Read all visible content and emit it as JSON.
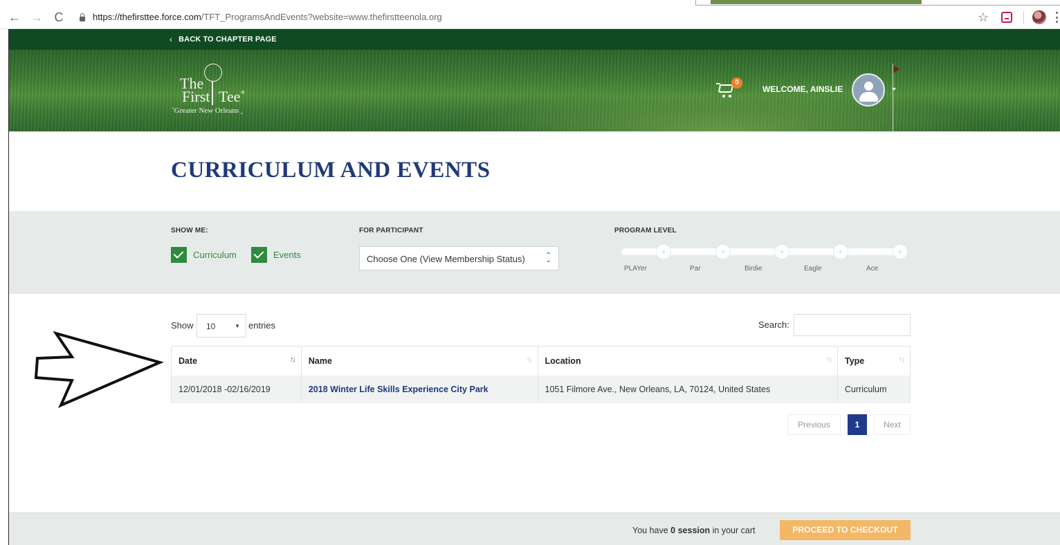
{
  "browser": {
    "url_host": "https://thefirsttee.force.com",
    "url_path": "/TFT_ProgramsAndEvents?website=www.thefirstteenola.org",
    "back_glyph": "←",
    "forward_glyph": "→",
    "reload_glyph": "C",
    "star_glyph": "☆"
  },
  "header": {
    "back_label": "BACK TO CHAPTER PAGE",
    "back_chevron": "‹",
    "logo": {
      "word1": "The",
      "word2": "First",
      "word3": "Tee˚",
      "sub": "˚Greater New Orleans ˛"
    },
    "cart_count": "0",
    "welcome": "WELCOME, AINSLIE",
    "hero_colors": {
      "dark_green": "#0f4a22",
      "grass": "#3f7d33"
    }
  },
  "page_title": "CURRICULUM AND EVENTS",
  "filters": {
    "show_me_label": "SHOW ME:",
    "curriculum_label": "Curriculum",
    "events_label": "Events",
    "participant_label": "FOR PARTICIPANT",
    "participant_value": "Choose One (View Membership Status)",
    "program_level_label": "PROGRAM LEVEL",
    "levels": [
      "PLAYer",
      "Par",
      "Birdie",
      "Eagle",
      "Ace"
    ],
    "check_color": "#2e8b3e"
  },
  "table_controls": {
    "show_label": "Show",
    "entries_value": "10",
    "entries_label": "entries",
    "search_label": "Search:"
  },
  "table": {
    "headers": [
      "Date",
      "Name",
      "Location",
      "Type"
    ],
    "rows": [
      {
        "date": "12/01/2018 -02/16/2019",
        "name": "2018 Winter Life Skills Experience City Park",
        "location": "1051 Filmore Ave., New Orleans, LA, 70124, United States",
        "type": "Curriculum"
      }
    ]
  },
  "pagination": {
    "previous": "Previous",
    "current": "1",
    "next": "Next"
  },
  "footer": {
    "cart_prefix": "You have",
    "cart_count": "0 session",
    "cart_suffix": "in your cart",
    "checkout_label": "PROCEED TO CHECKOUT",
    "checkout_color": "#f4b766"
  },
  "accent_colors": {
    "title_blue": "#1f3a7a",
    "pager_blue": "#1f3a8a",
    "badge_orange": "#f0802b"
  }
}
